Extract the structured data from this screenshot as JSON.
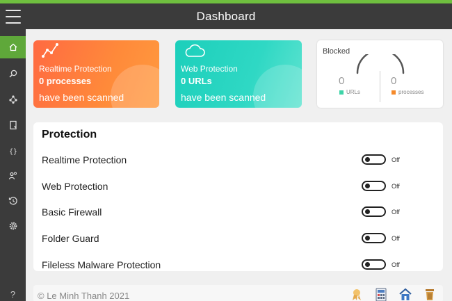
{
  "window": {
    "title": "Dashboard"
  },
  "sidebar": {
    "items": [
      {
        "name": "home-icon",
        "active": true
      },
      {
        "name": "search-icon",
        "active": false
      },
      {
        "name": "network-icon",
        "active": false
      },
      {
        "name": "document-icon",
        "active": false
      },
      {
        "name": "braces-icon",
        "active": false
      },
      {
        "name": "people-icon",
        "active": false
      },
      {
        "name": "history-icon",
        "active": false
      },
      {
        "name": "settings-icon",
        "active": false
      }
    ],
    "help_label": "?"
  },
  "cards": {
    "realtime": {
      "title": "Realtime Protection",
      "value": "0 processes",
      "subtitle": "have been scanned",
      "icon": "graph-icon",
      "color_start": "#ff6a42",
      "color_end": "#ff9a3f"
    },
    "web": {
      "title": "Web Protection",
      "value": "0 URLs",
      "subtitle": "have been scanned",
      "icon": "cloud-icon",
      "color_start": "#1ccfbb",
      "color_end": "#5fe3d0"
    },
    "blocked": {
      "title": "Blocked",
      "urls_value": "0",
      "urls_label": "URLs",
      "urls_color": "#3ed4a8",
      "processes_value": "0",
      "processes_label": "processes",
      "processes_color": "#f58a2b"
    }
  },
  "protection": {
    "title": "Protection",
    "rows": [
      {
        "label": "Realtime Protection",
        "state": "Off"
      },
      {
        "label": "Web Protection",
        "state": "Off"
      },
      {
        "label": "Basic Firewall",
        "state": "Off"
      },
      {
        "label": "Folder Guard",
        "state": "Off"
      },
      {
        "label": "Fileless Malware Protection",
        "state": "Off"
      }
    ]
  },
  "footer": {
    "copyright": "© Le Minh Thanh 2021",
    "icons": [
      "ribbon-icon",
      "calculator-icon",
      "home-app-icon",
      "trash-icon"
    ]
  },
  "colors": {
    "accent": "#5fa83a",
    "titlebar": "#3b3b3b",
    "background": "#f0f0f0"
  }
}
